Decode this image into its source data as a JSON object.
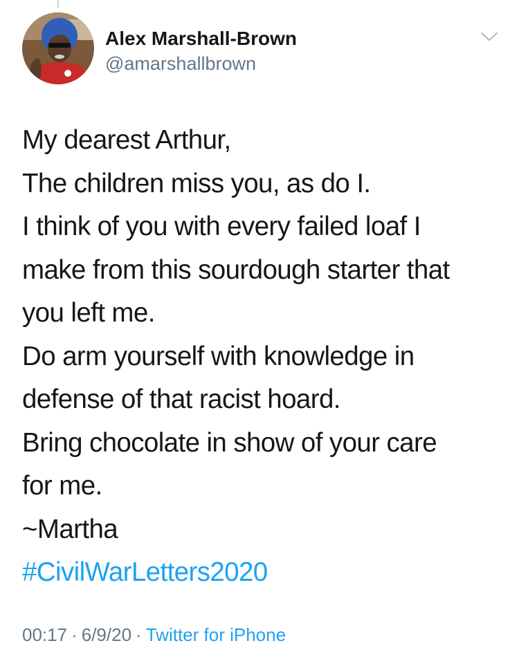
{
  "tweet": {
    "author": {
      "display_name": "Alex Marshall-Brown",
      "handle": "@amarshallbrown",
      "avatar": "user-avatar-photo"
    },
    "menu_icon": "chevron-down-icon",
    "body_lines": [
      "My dearest Arthur,",
      "The children miss you, as do I.",
      "I think of you with every failed loaf I",
      "make from this sourdough starter that",
      "you left me.",
      "Do arm yourself with knowledge in",
      "defense of that racist hoard.",
      "Bring chocolate in show of your care",
      "for me.",
      "~Martha"
    ],
    "hashtag": "#CivilWarLetters2020",
    "time": "00:17",
    "date": "6/9/20",
    "separator": "·",
    "source": "Twitter for iPhone"
  },
  "colors": {
    "text": "#14171a",
    "secondary": "#657786",
    "link": "#1da1f2"
  }
}
